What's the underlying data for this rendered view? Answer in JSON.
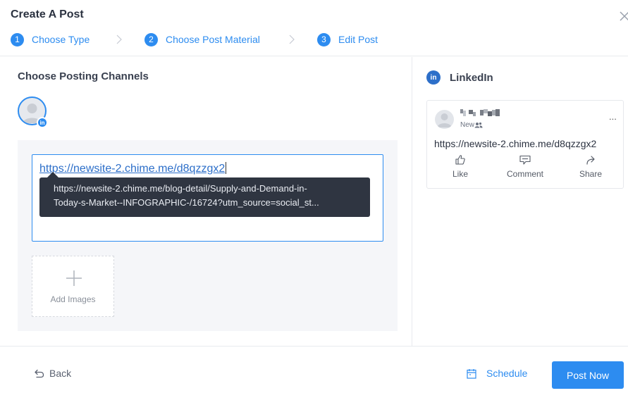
{
  "header": {
    "title": "Create A Post",
    "steps": [
      {
        "num": "1",
        "label": "Choose Type"
      },
      {
        "num": "2",
        "label": "Choose Post Material"
      },
      {
        "num": "3",
        "label": "Edit Post"
      }
    ]
  },
  "left": {
    "section_title": "Choose Posting Channels",
    "channel_badge": "in",
    "editor": {
      "url_text": "https://newsite-2.chime.me/d8qzzgx2"
    },
    "tooltip": {
      "line1": "https://newsite-2.chime.me/blog-detail/Supply-and-Demand-in-",
      "line2": "Today-s-Market--INFOGRAPHIC-/16724?utm_source=social_st..."
    },
    "add_images_label": "Add Images"
  },
  "right": {
    "title": "LinkedIn",
    "logo_text": "in",
    "preview": {
      "sub_label": "New",
      "more": "...",
      "text": "https://newsite-2.chime.me/d8qzzgx2",
      "actions": [
        {
          "label": "Like",
          "icon": "thumbs-up-icon"
        },
        {
          "label": "Comment",
          "icon": "comment-icon"
        },
        {
          "label": "Share",
          "icon": "share-icon"
        }
      ]
    }
  },
  "footer": {
    "back_label": "Back",
    "schedule_label": "Schedule",
    "post_now_label": "Post Now"
  },
  "colors": {
    "accent": "#2d8cf0",
    "tooltip_bg": "#2f3541",
    "panel_bg": "#f5f6f9"
  }
}
